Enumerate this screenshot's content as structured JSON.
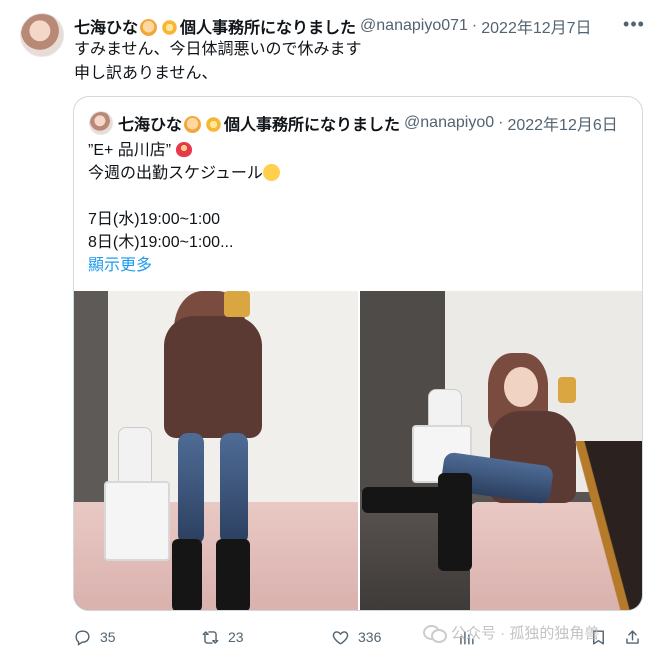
{
  "tweet": {
    "name": "七海ひな",
    "name_suffix": "個人事務所になりました",
    "handle": "@nanapiyo071",
    "date": "2022年12月7日",
    "text_lines": [
      "すみません、今日体調悪いので休みます",
      "申し訳ありません、"
    ]
  },
  "quote": {
    "name": "七海ひな",
    "name_suffix": "個人事務所になりました",
    "handle": "@nanapiyo0",
    "date": "2022年12月6日",
    "line1": "”E+ 品川店”",
    "line2": "今週の出勤スケジュール",
    "line3": "",
    "line4": "7日(水)19:00~1:00",
    "line5": "8日(木)19:00~1:00...",
    "show_more": "顯示更多"
  },
  "actions": {
    "replies": "35",
    "retweets": "23",
    "likes": "336"
  },
  "watermark": {
    "text": "公众号 · 孤独的独角兽"
  },
  "icons": {
    "more": "more-icon",
    "reply": "reply-icon",
    "retweet": "retweet-icon",
    "like": "heart-icon",
    "views": "views-icon",
    "bookmark": "bookmark-icon",
    "share": "share-icon"
  }
}
